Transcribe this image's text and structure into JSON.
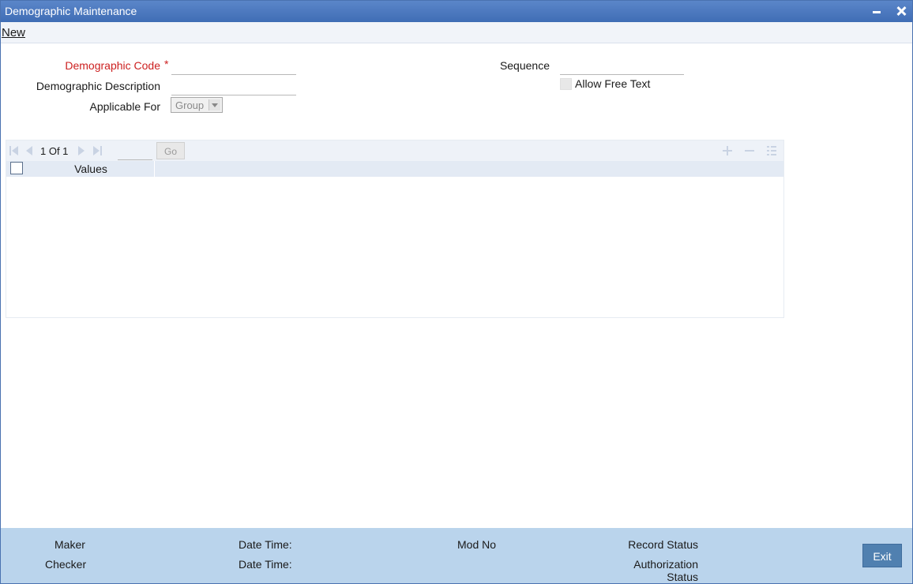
{
  "window": {
    "title": "Demographic Maintenance"
  },
  "menu": {
    "new_label": "New"
  },
  "form": {
    "demographic_code_label": "Demographic Code",
    "required_mark": "*",
    "demographic_code_value": "",
    "demographic_description_label": "Demographic Description",
    "demographic_description_value": "",
    "applicable_for_label": "Applicable For",
    "applicable_for_value": "Group",
    "sequence_label": "Sequence",
    "sequence_value": "",
    "allow_free_text_label": "Allow Free Text",
    "allow_free_text_checked": false
  },
  "grid": {
    "page_text": "1 Of 1",
    "page_input_value": "",
    "go_label": "Go",
    "columns": [
      "Values"
    ],
    "rows": []
  },
  "footer": {
    "maker_label": "Maker",
    "checker_label": "Checker",
    "maker_datetime_label": "Date Time:",
    "checker_datetime_label": "Date Time:",
    "mod_no_label": "Mod No",
    "record_status_label": "Record Status",
    "authorization_label": "Authorization",
    "authorization_status_label": "Status",
    "exit_label": "Exit"
  },
  "colors": {
    "titlebar": "#3f6db5",
    "required": "#cc1f1f",
    "footer": "#bad4ec",
    "exit_button": "#5080b0"
  },
  "icons": [
    "minimize-icon",
    "close-icon",
    "first-page-icon",
    "prev-page-icon",
    "next-page-icon",
    "last-page-icon",
    "add-row-icon",
    "remove-row-icon",
    "list-view-icon"
  ]
}
